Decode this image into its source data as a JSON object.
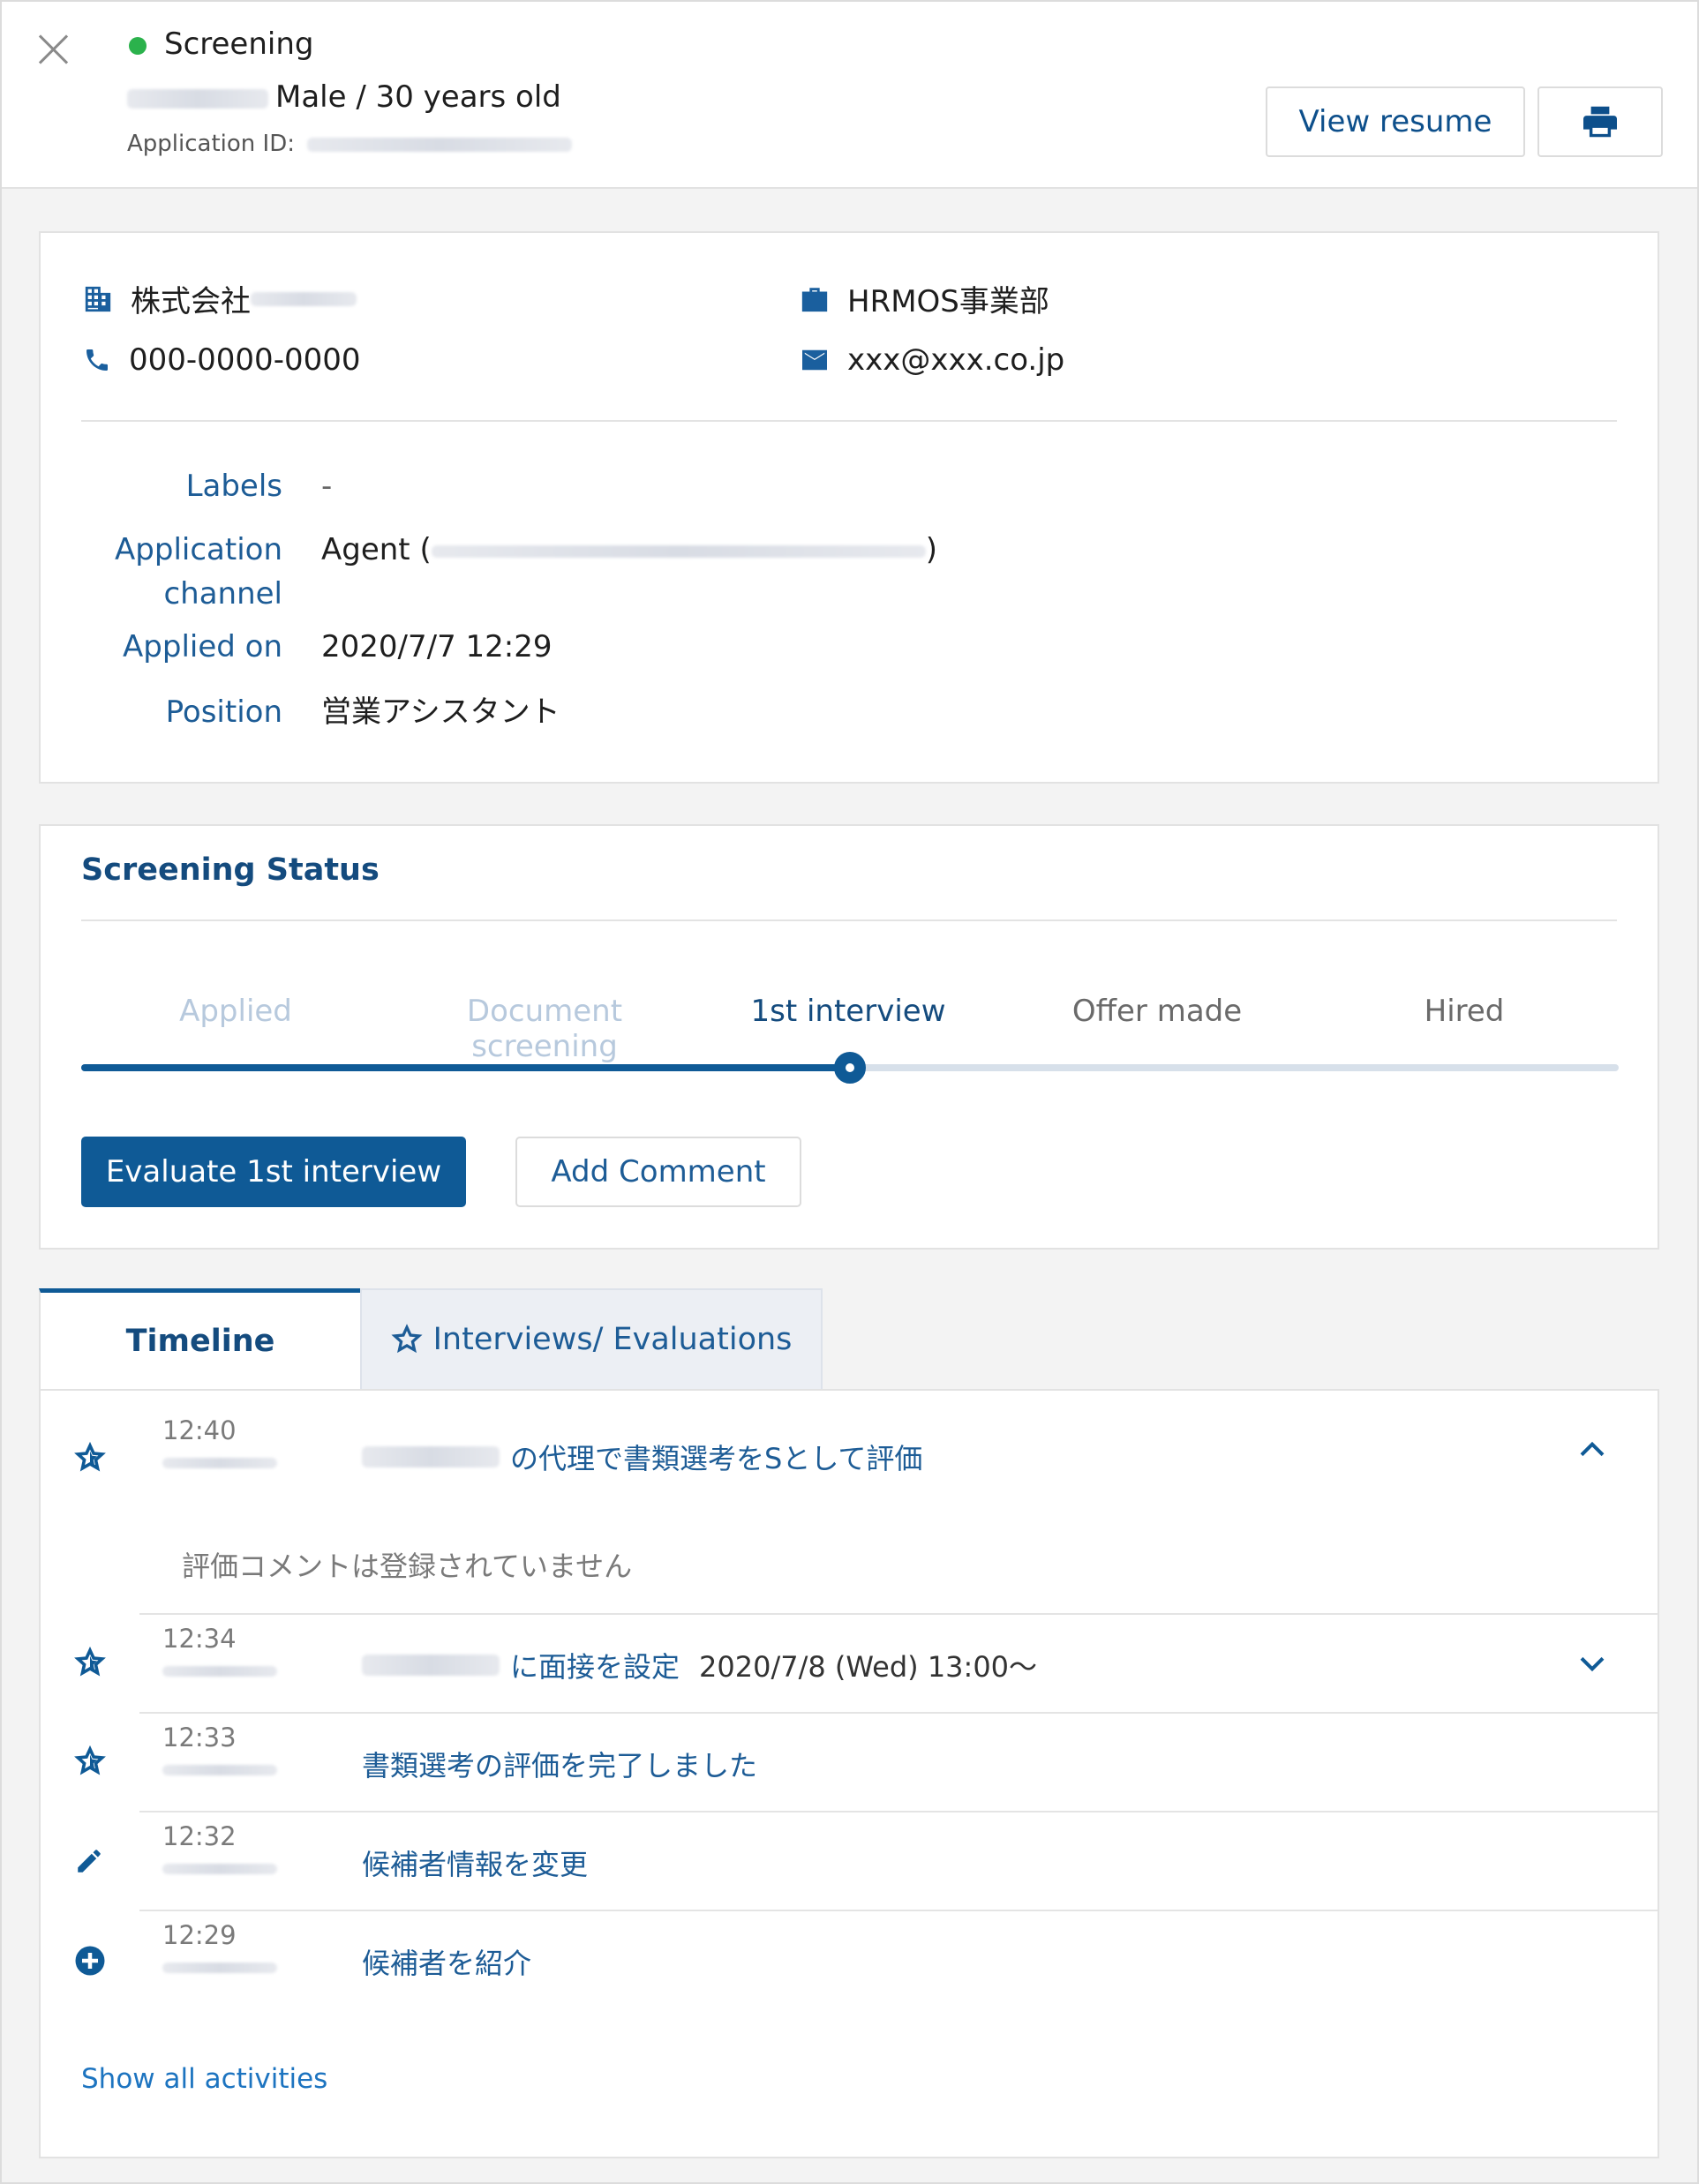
{
  "header": {
    "status": "Screening",
    "status_color": "#2bb24c",
    "candidate_info": "Male / 30 years old",
    "application_id_label": "Application ID:",
    "view_resume_label": "View resume",
    "print_icon": "printer-icon",
    "close_icon": "close-icon"
  },
  "contact": {
    "company": "株式会社",
    "department": "HRMOS事業部",
    "phone": "000-0000-0000",
    "email": "xxx@xxx.co.jp"
  },
  "details": {
    "labels_label": "Labels",
    "labels_value": "-",
    "channel_label_1": "Application",
    "channel_label_2": "channel",
    "channel_value_prefix": "Agent (",
    "channel_value_suffix": ")",
    "applied_label": "Applied on",
    "applied_value": "2020/7/7 12:29",
    "position_label": "Position",
    "position_value": "営業アシスタント"
  },
  "screening": {
    "title": "Screening Status",
    "steps": [
      "Applied",
      "Document screening",
      "1st interview",
      "Offer made",
      "Hired"
    ],
    "current_step_index": 2,
    "progress_fraction": 0.5,
    "evaluate_label": "Evaluate 1st interview",
    "comment_label": "Add Comment",
    "accent_color": "#0f5a96"
  },
  "tabs": {
    "timeline": "Timeline",
    "interviews": "Interviews/ Evaluations"
  },
  "timeline": {
    "items": [
      {
        "time": "12:40",
        "text": "の代理で書類選考をSとして評価",
        "comment": "評価コメントは登録されていません",
        "icon": "star-icon"
      },
      {
        "time": "12:34",
        "text": "に面接を設定",
        "extra": "2020/7/8 (Wed) 13:00～",
        "icon": "star-icon"
      },
      {
        "time": "12:33",
        "text": "書類選考の評価を完了しました",
        "icon": "star-icon"
      },
      {
        "time": "12:32",
        "text": "候補者情報を変更",
        "icon": "pencil-icon"
      },
      {
        "time": "12:29",
        "text": "候補者を紹介",
        "icon": "plus-circle-icon"
      }
    ],
    "show_all": "Show all activities"
  }
}
